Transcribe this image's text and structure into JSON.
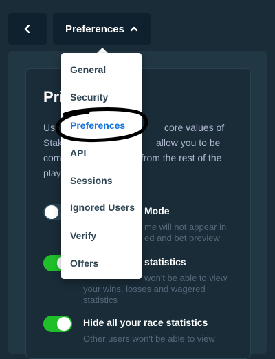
{
  "topbar": {
    "back_icon": "chevron-left-icon",
    "menu_label": "Preferences",
    "menu_icon": "chevron-up-icon"
  },
  "card": {
    "title_visible": "Priv",
    "description_fragments": [
      "Us",
      "core values of",
      "Stak",
      "allow you to be",
      "com",
      "s from the rest of the",
      "play"
    ]
  },
  "settings": [
    {
      "state": "off",
      "title_fragment": "Mode",
      "desc_fragments": [
        "me will not appear in",
        "ed and bet preview"
      ]
    },
    {
      "state": "on",
      "title_fragment": "statistics",
      "desc_fragments": [
        "won't be able to view",
        "your wins, losses and wagered",
        "statistics"
      ]
    },
    {
      "state": "on",
      "title": "Hide all your race statistics",
      "desc": "Other users won't be able to view"
    }
  ],
  "dropdown": {
    "items": [
      {
        "label": "General",
        "active": false
      },
      {
        "label": "Security",
        "active": false
      },
      {
        "label": "Preferences",
        "active": true
      },
      {
        "label": "API",
        "active": false
      },
      {
        "label": "Sessions",
        "active": false
      },
      {
        "label": "Ignored Users",
        "active": false
      },
      {
        "label": "Verify",
        "active": false
      },
      {
        "label": "Offers",
        "active": false
      }
    ]
  },
  "colors": {
    "background": "#1a2c38",
    "panel": "#213743",
    "button": "#0f212e",
    "toggle_on": "#1fbf2a",
    "active_link": "#1475e1"
  }
}
